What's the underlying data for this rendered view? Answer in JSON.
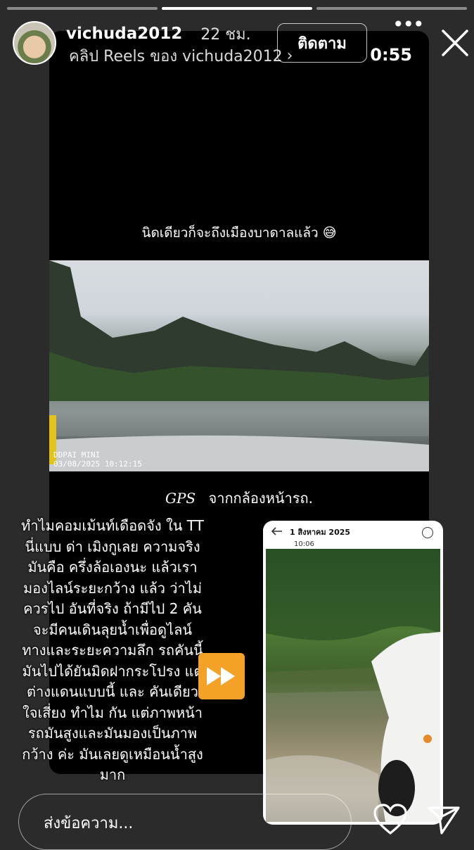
{
  "story": {
    "progress_segments": 3,
    "active_segment": 1
  },
  "user": {
    "username": "vichuda2012",
    "timeago": "22 ชม.",
    "follow_label": "ติดตาม"
  },
  "reel": {
    "header_text": "คลิป Reels ของ vichuda2012",
    "duration": "0:55",
    "caption_top": "นิดเดียวก็จะถึงเมืองบาดาลแล้ว 😅",
    "dash_brand": "DDPAI MINI",
    "dash_timestamp": "03/08/2025 10:12:15",
    "gps_label": "GPS",
    "gps_caption": "จากกล้องหน้ารถ."
  },
  "comment": {
    "text": "ทำไมคอมเม้นท์เดือดจัง ใน TT นี่แบบ ด่า เมิงกูเลย ความจริง มันคือ ครึ่งล้อเองนะ แล้วเรามองไลน์ระยะกว้าง แล้ว ว่าไม่ควรไป อันที่จริง ถ้ามีไป 2 คัน จะมีคนเดินลุยน้ำเพื่อดูไลน์ทางและระยะความลึก รถคันนี้มันไปได้ยันมิดฝากระโปรง แต่ต่างแดนแบบนี้ และ คันเดียวใจเสี่ยง ทำไม กัน แต่ภาพหน้ารถมันสูงและมันมองเป็นภาพกว้าง ค่ะ มันเลยดูเหมือนน้ำสูงมาก"
  },
  "phone_shot": {
    "date": "1 สิงหาคม 2025",
    "time": "10:06"
  },
  "footer": {
    "message_placeholder": "ส่งข้อความ..."
  },
  "icons": {
    "close": "close-icon",
    "more": "more-icon",
    "forward": "fast-forward-icon",
    "heart": "heart-icon",
    "send": "send-icon",
    "back": "back-arrow-icon"
  },
  "colors": {
    "background": "#2b2b2b",
    "forward_accent": "#f4a128"
  }
}
